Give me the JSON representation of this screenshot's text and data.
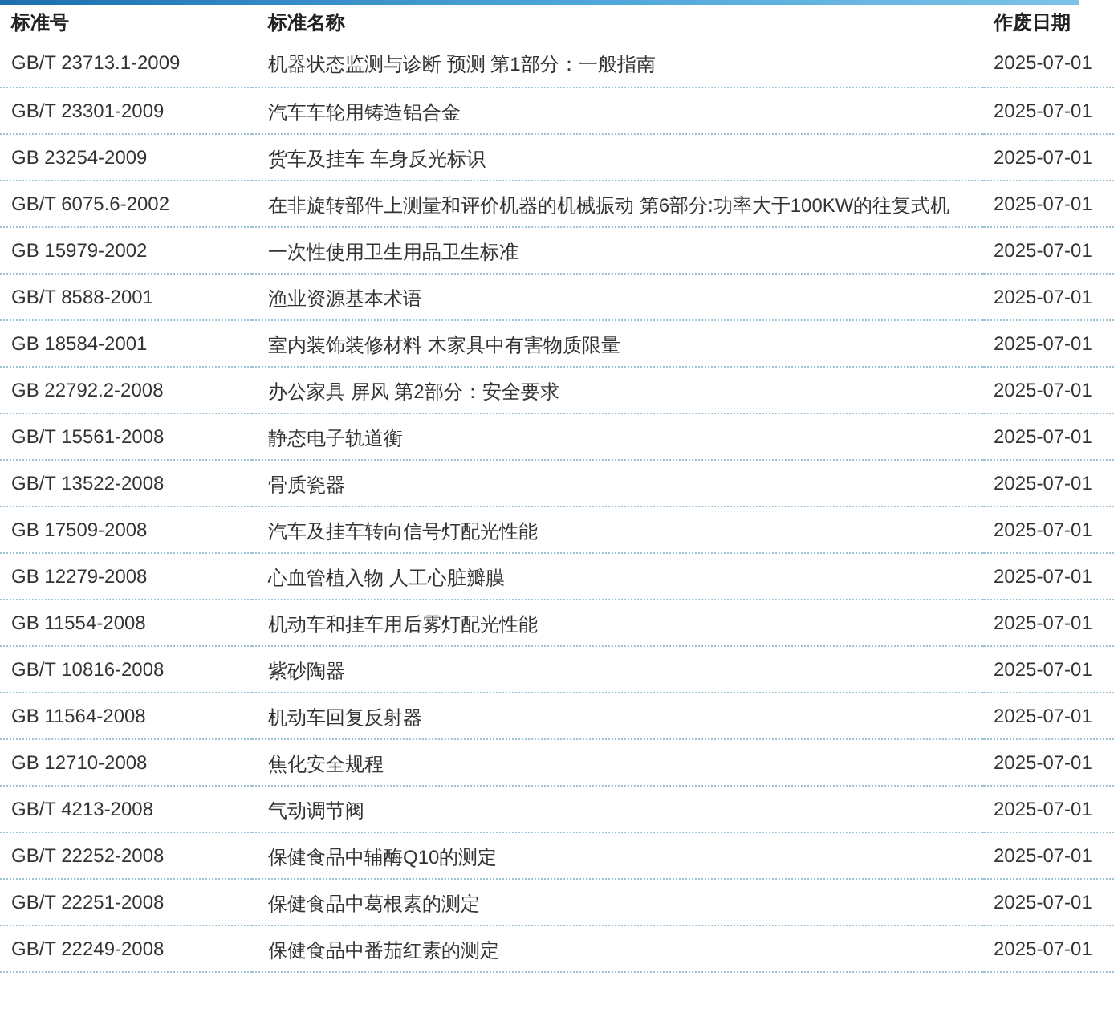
{
  "table": {
    "columns": [
      "标准号",
      "标准名称",
      "作废日期"
    ],
    "rows": [
      [
        "GB/T 23713.1-2009",
        "机器状态监测与诊断 预测 第1部分：一般指南",
        "2025-07-01"
      ],
      [
        "GB/T 23301-2009",
        "汽车车轮用铸造铝合金",
        "2025-07-01"
      ],
      [
        "GB 23254-2009",
        "货车及挂车 车身反光标识",
        "2025-07-01"
      ],
      [
        "GB/T 6075.6-2002",
        "在非旋转部件上测量和评价机器的机械振动 第6部分:功率大于100KW的往复式机",
        "2025-07-01"
      ],
      [
        "GB 15979-2002",
        "一次性使用卫生用品卫生标准",
        "2025-07-01"
      ],
      [
        "GB/T 8588-2001",
        "渔业资源基本术语",
        "2025-07-01"
      ],
      [
        "GB 18584-2001",
        "室内装饰装修材料 木家具中有害物质限量",
        "2025-07-01"
      ],
      [
        "GB 22792.2-2008",
        "办公家具 屏风 第2部分：安全要求",
        "2025-07-01"
      ],
      [
        "GB/T 15561-2008",
        "静态电子轨道衡",
        "2025-07-01"
      ],
      [
        "GB/T 13522-2008",
        "骨质瓷器",
        "2025-07-01"
      ],
      [
        "GB 17509-2008",
        "汽车及挂车转向信号灯配光性能",
        "2025-07-01"
      ],
      [
        "GB 12279-2008",
        "心血管植入物 人工心脏瓣膜",
        "2025-07-01"
      ],
      [
        "GB 11554-2008",
        "机动车和挂车用后雾灯配光性能",
        "2025-07-01"
      ],
      [
        "GB/T 10816-2008",
        "紫砂陶器",
        "2025-07-01"
      ],
      [
        "GB 11564-2008",
        "机动车回复反射器",
        "2025-07-01"
      ],
      [
        "GB 12710-2008",
        "焦化安全规程",
        "2025-07-01"
      ],
      [
        "GB/T 4213-2008",
        "气动调节阀",
        "2025-07-01"
      ],
      [
        "GB/T 22252-2008",
        "保健食品中辅酶Q10的测定",
        "2025-07-01"
      ],
      [
        "GB/T 22251-2008",
        "保健食品中葛根素的测定",
        "2025-07-01"
      ],
      [
        "GB/T 22249-2008",
        "保健食品中番茄红素的测定",
        "2025-07-01"
      ]
    ]
  }
}
